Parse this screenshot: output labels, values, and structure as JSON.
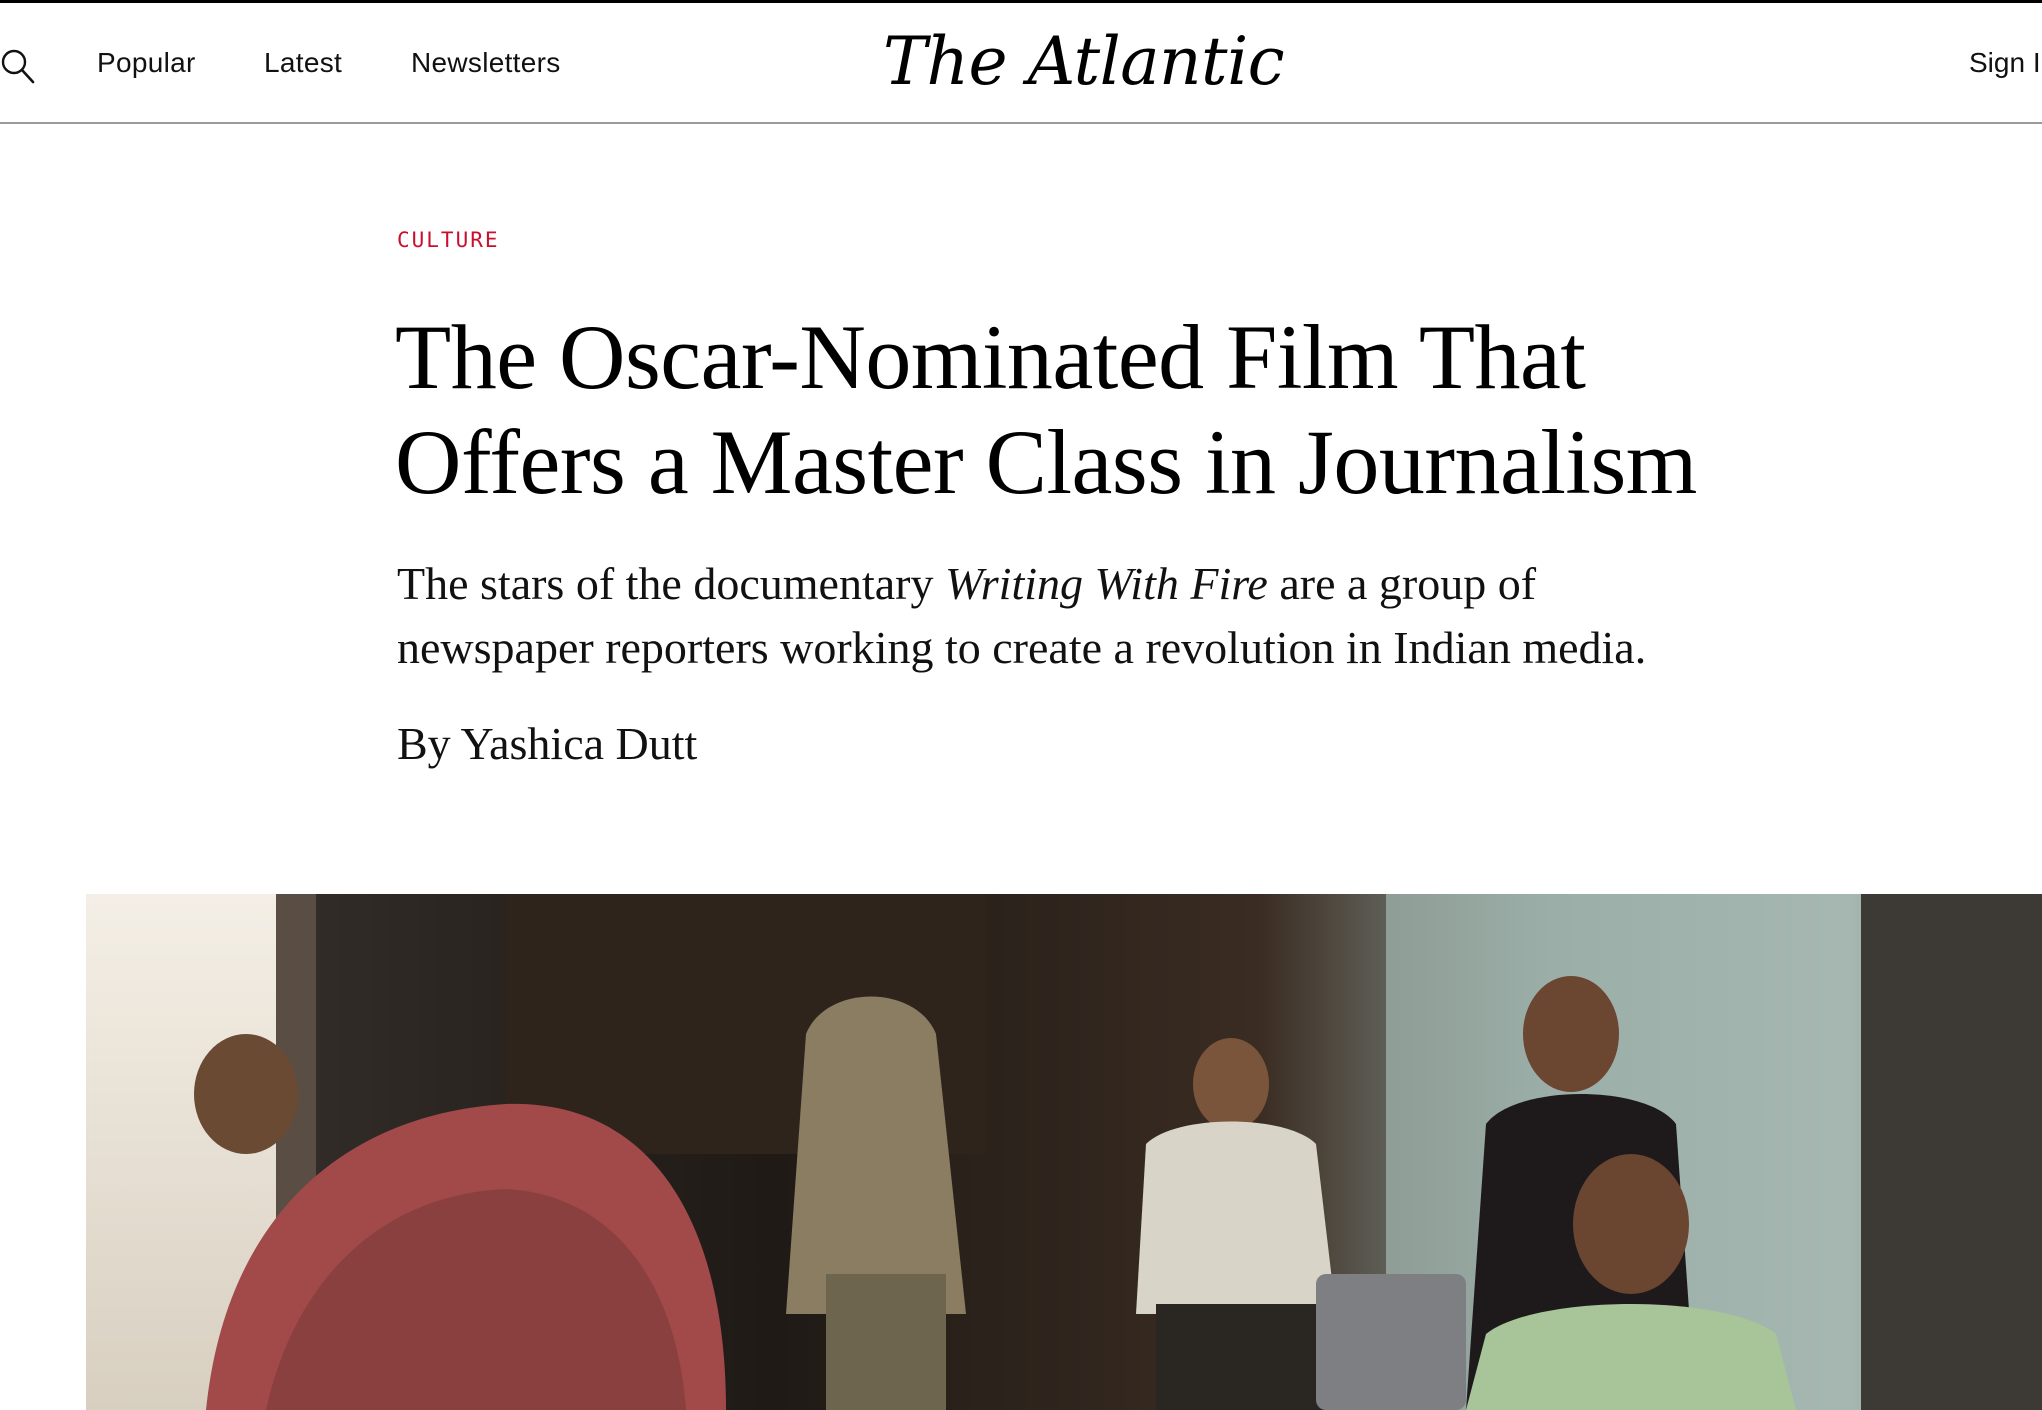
{
  "nav": {
    "search_icon": "search-icon",
    "items": [
      "Popular",
      "Latest",
      "Newsletters"
    ],
    "logo": "The Atlantic",
    "sign_in": "Sign I"
  },
  "article": {
    "section": "CULTURE",
    "headline_line1": "The Oscar-Nominated Film That",
    "headline_line2": "Offers a Master Class in Journalism",
    "dek_before": "The stars of the documentary ",
    "dek_title": "Writing With Fire",
    "dek_after": " are a group of newspaper reporters working to create a revolution in Indian media.",
    "byline_prefix": "By ",
    "author": "Yashica Dutt"
  },
  "colors": {
    "section_red": "#c8102e",
    "text": "#000000",
    "divider": "#9a9a9a"
  }
}
